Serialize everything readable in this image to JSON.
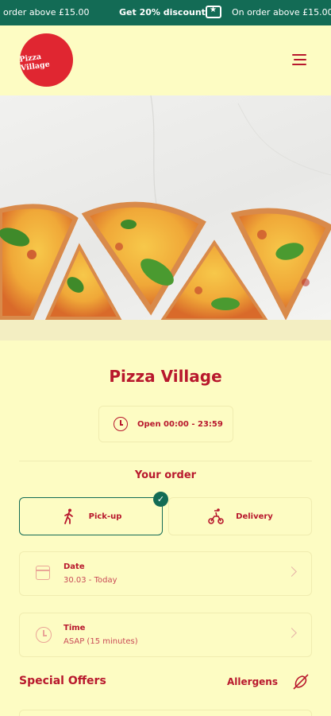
{
  "promo": {
    "left_text": "order above £15.00",
    "center_text": "Get 20% discount",
    "right_text": "On order above £15.00"
  },
  "header": {
    "logo_text": "Pizza Village"
  },
  "restaurant": {
    "name": "Pizza Village",
    "hours": "Open 00:00 - 23:59"
  },
  "order": {
    "heading": "Your order",
    "pickup_label": "Pick-up",
    "delivery_label": "Delivery",
    "selected": "Pick-up",
    "date_label": "Date",
    "date_value": "30.03 - Today",
    "time_label": "Time",
    "time_value": "ASAP (15 minutes)"
  },
  "sections": {
    "special_offers": "Special Offers",
    "allergens": "Allergens"
  },
  "colors": {
    "accent": "#b8182d",
    "banner": "#136b55",
    "background": "#fdfcc3"
  }
}
